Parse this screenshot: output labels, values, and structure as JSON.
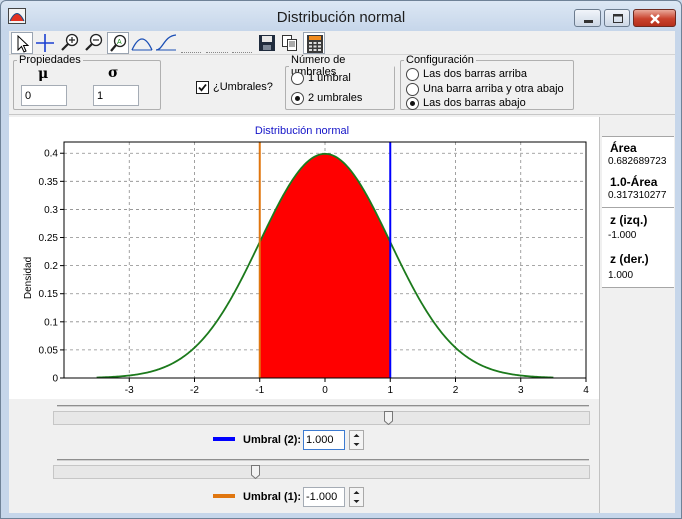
{
  "window": {
    "title": "Distribución normal"
  },
  "properties": {
    "legend": "Propiedades",
    "mu_symbol": "μ",
    "sigma_symbol": "σ",
    "mu_value": "0",
    "sigma_value": "1"
  },
  "thresholds_toggle": {
    "label": "¿Umbrales?",
    "checked": true
  },
  "num_thresholds": {
    "legend": "Número de umbrales",
    "options": [
      "1 umbral",
      "2 umbrales"
    ],
    "selected": "2 umbrales"
  },
  "configuration": {
    "legend": "Configuración",
    "options": [
      "Las dos barras arriba",
      "Una barra arriba y otra abajo",
      "Las dos barras abajo"
    ],
    "selected": "Las dos barras abajo"
  },
  "toolbar": {
    "icons": [
      "pointer-icon",
      "crosshair-icon",
      "zoom-in-icon",
      "zoom-out-icon",
      "zoom-fit-icon",
      "density-curve-icon",
      "cumulative-curve-icon",
      "save-icon",
      "copy-icon",
      "calculator-icon"
    ]
  },
  "results": {
    "area_label": "Área",
    "area_value": "0.682689723",
    "complement_label": "1.0-Área",
    "complement_value": "0.317310277",
    "z_left_label": "z (izq.)",
    "z_left_value": "-1.000",
    "z_right_label": "z (der.)",
    "z_right_value": "1.000"
  },
  "controls": {
    "threshold2_label": "Umbral (2):",
    "threshold2_value": "1.000",
    "threshold1_label": "Umbral (1):",
    "threshold1_value": "-1.000"
  },
  "colors": {
    "curve": "#1c7a1c",
    "fill": "#ff0000",
    "threshold2": "#0000ff",
    "threshold1": "#e0760f",
    "title": "#1414c8"
  },
  "chart_data": {
    "type": "area",
    "title": "Distribución normal",
    "xlabel": "",
    "ylabel": "Densidad",
    "xlim": [
      -4,
      4
    ],
    "ylim": [
      0,
      0.42
    ],
    "x_ticks": [
      -3,
      -2,
      -1,
      0,
      1,
      2,
      3,
      4
    ],
    "y_ticks": [
      0,
      0.05,
      0.1,
      0.15,
      0.2,
      0.25,
      0.3,
      0.35,
      0.4
    ],
    "grid": true,
    "curve_domain": [
      -3.5,
      3.5
    ],
    "series": [
      {
        "distribution": "normal",
        "mu": 0,
        "sigma": 1
      }
    ],
    "shaded_region": [
      -1,
      1
    ],
    "threshold_lines": [
      -1,
      1
    ]
  }
}
